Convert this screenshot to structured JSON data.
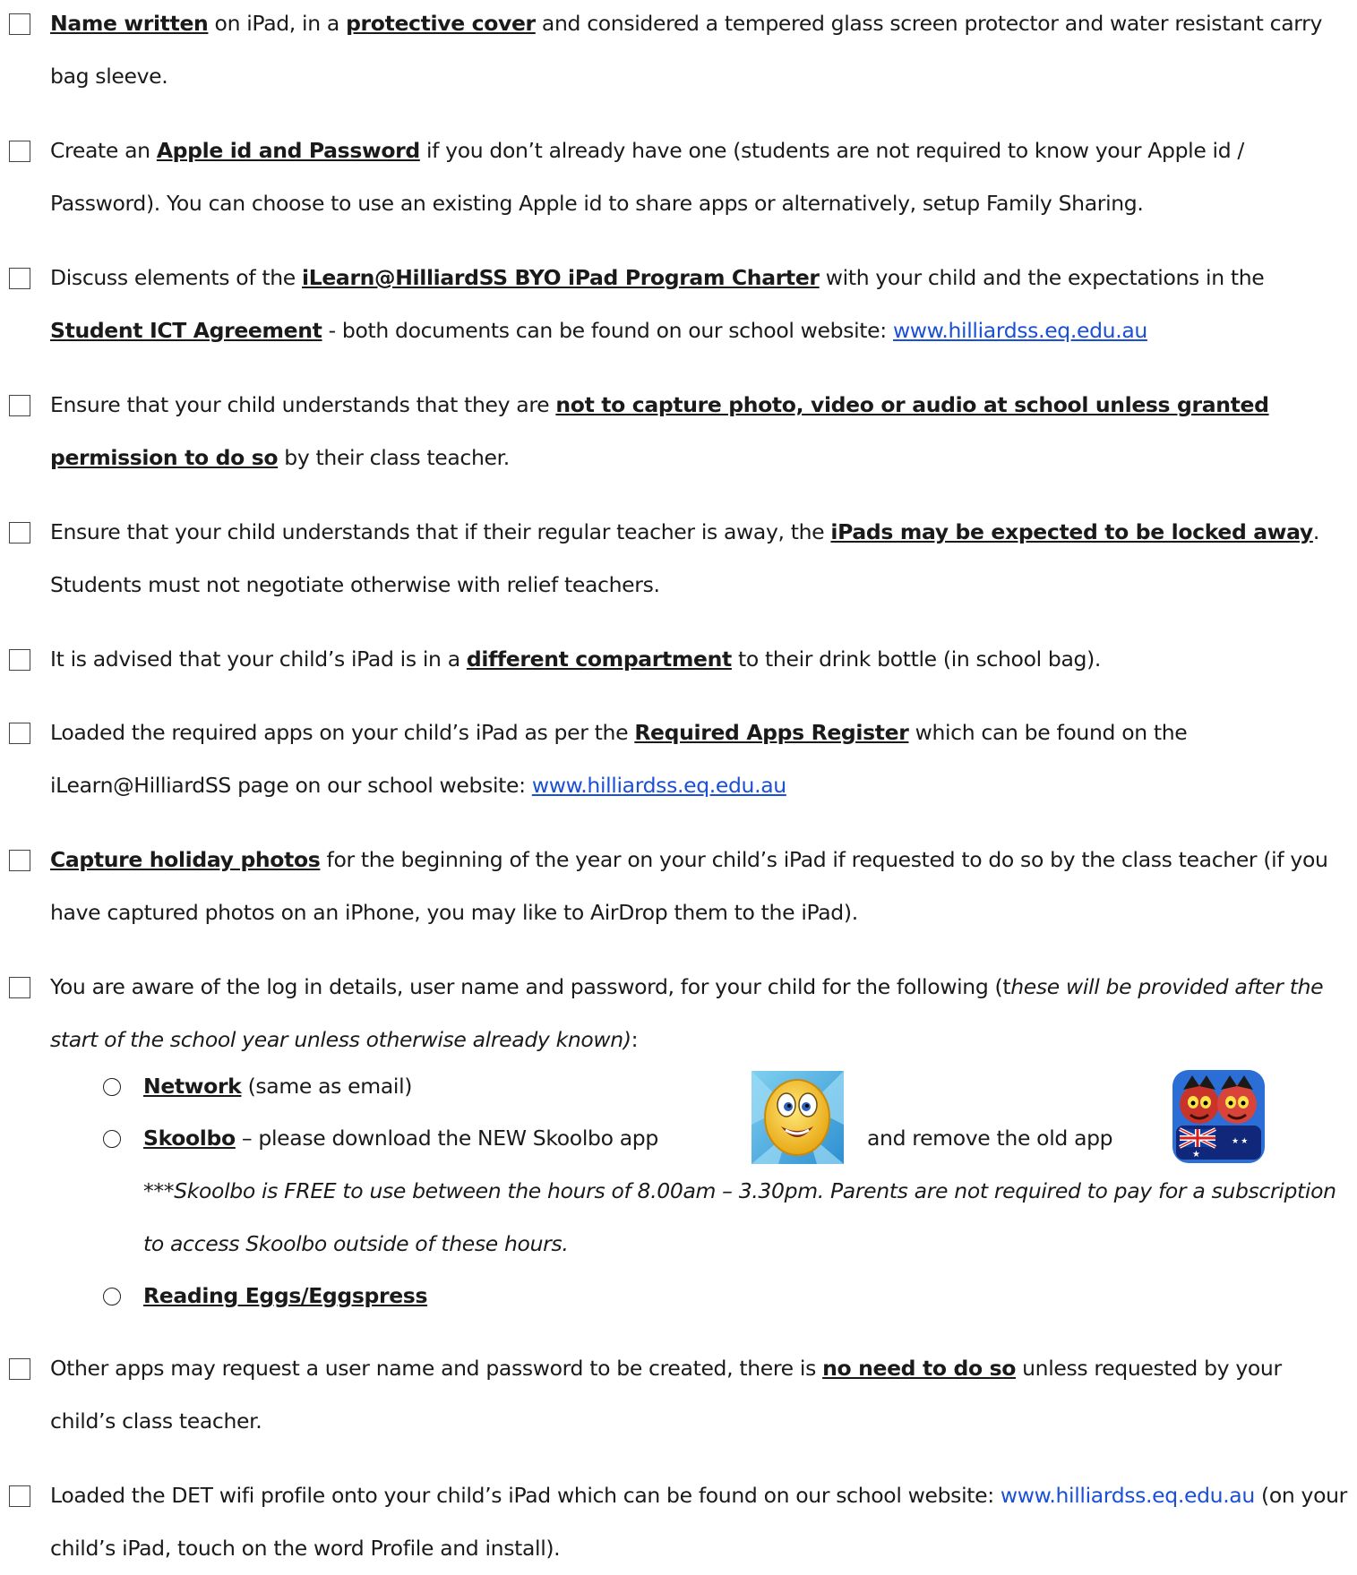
{
  "items": [
    {
      "parts": [
        {
          "t": "Name written",
          "b": 1
        },
        {
          "t": " on iPad, in a "
        },
        {
          "t": "protective cover",
          "b": 1
        },
        {
          "t": " and considered a tempered glass screen protector and water resistant carry bag sleeve."
        }
      ]
    },
    {
      "parts": [
        {
          "t": "Create an "
        },
        {
          "t": "Apple id and Password",
          "b": 1
        },
        {
          "t": " if you don’t already have one (students are not required to know your Apple id / Password). You can choose to use an existing Apple id to share apps or alternatively, setup Family Sharing."
        }
      ]
    },
    {
      "parts": [
        {
          "t": "Discuss elements of the "
        },
        {
          "t": "iLearn@HilliardSS BYO iPad Program Charter",
          "b": 1
        },
        {
          "t": " with your child and the expectations in the "
        },
        {
          "t": "Student ICT Agreement",
          "b": 1
        },
        {
          "t": " - both documents can be found on our school website: "
        },
        {
          "t": "www.hilliardss.eq.edu.au",
          "link": 1
        }
      ]
    },
    {
      "parts": [
        {
          "t": "Ensure that your child understands that they are "
        },
        {
          "t": "not to capture photo, video or audio at school unless granted permission to do so",
          "b": 1
        },
        {
          "t": " by their class teacher."
        }
      ]
    },
    {
      "parts": [
        {
          "t": "Ensure that your child understands that if their regular teacher is away, the "
        },
        {
          "t": "iPads may be expected to be locked away",
          "b": 1
        },
        {
          "t": ". Students must not negotiate otherwise with relief teachers."
        }
      ]
    },
    {
      "parts": [
        {
          "t": "It is advised that your child’s iPad is in a "
        },
        {
          "t": "different compartment",
          "b": 1
        },
        {
          "t": " to their drink bottle (in school bag)."
        }
      ]
    },
    {
      "parts": [
        {
          "t": "Loaded the required apps on your child’s iPad as per the "
        },
        {
          "t": "Required Apps Register",
          "b": 1
        },
        {
          "t": " which can be found on the iLearn@HilliardSS page on our school website: "
        },
        {
          "t": "www.hilliardss.eq.edu.au",
          "link": 1
        }
      ]
    },
    {
      "parts": [
        {
          "t": "Capture holiday photos",
          "b": 1
        },
        {
          "t": " for the beginning of the year on your child’s iPad if requested to do so by the class teacher (if you have captured photos on an iPhone, you may like to AirDrop them to the iPad)."
        }
      ]
    },
    {
      "parts": [
        {
          "t": "You are aware of the log in details, user name and password, for your child for the following (t"
        },
        {
          "t": "hese will be provided after the start of the school year unless otherwise already known)",
          "i": 1
        },
        {
          "t": ":"
        }
      ]
    },
    {
      "parts": [
        {
          "t": "Other apps may request a user name and password to be created, there is "
        },
        {
          "t": "no need to do so",
          "b": 1
        },
        {
          "t": " unless requested by your child’s class teacher."
        }
      ]
    },
    {
      "parts": [
        {
          "t": "Loaded the DET wifi profile onto your child’s iPad which can be found on our school website: "
        },
        {
          "t": "www.hilliardss.eq.edu.au",
          "plainlink": 1
        },
        {
          "t": " (on your child’s iPad, touch on the word Profile and install)."
        }
      ]
    }
  ],
  "sub_items": {
    "network": {
      "label": "Network",
      "rest": " (same as email)"
    },
    "skoolbo": {
      "label": "Skoolbo",
      "rest": " – please download the NEW Skoolbo app",
      "rest2": "and remove the old app"
    },
    "note": "***Skoolbo is FREE to use between the hours of 8.00am – 3.30pm. Parents are not required to pay for a subscription to access Skoolbo outside of these hours.",
    "reading": {
      "label": "Reading Eggs/Eggspress"
    }
  },
  "icons": {
    "new_app": "skoolbo-new-app-icon",
    "old_app": "skoolbo-old-app-icon"
  },
  "colors": {
    "link": "#1a4fd6",
    "text": "#1a1a1a"
  }
}
